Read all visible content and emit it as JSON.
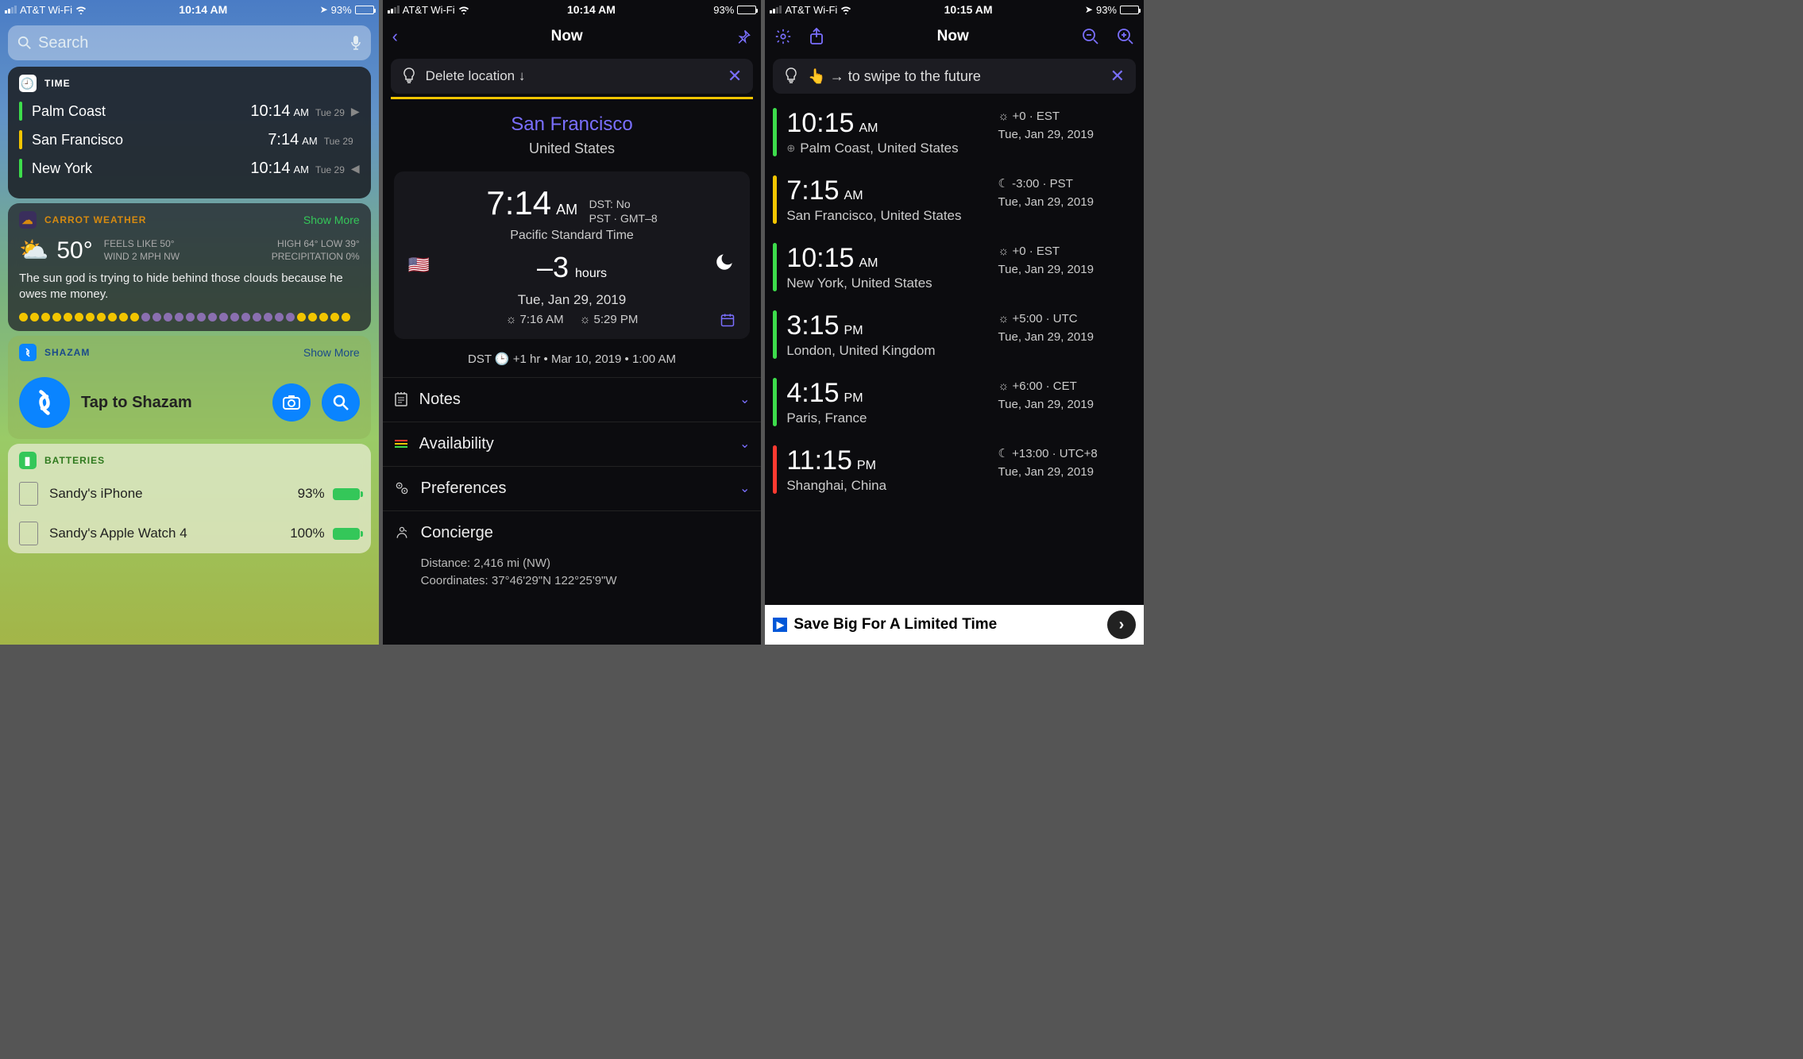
{
  "status": {
    "carrier": "AT&T Wi-Fi",
    "time_a": "10:14 AM",
    "time_b": "10:14 AM",
    "time_c": "10:15 AM",
    "battery_pct": "93%"
  },
  "phone1": {
    "search_placeholder": "Search",
    "time_widget": {
      "title": "TIME",
      "rows": [
        {
          "city": "Palm Coast",
          "time": "10:14",
          "ampm": "AM",
          "date": "Tue 29",
          "bar": "green",
          "chev": "▶"
        },
        {
          "city": "San Francisco",
          "time": "7:14",
          "ampm": "AM",
          "date": "Tue 29",
          "bar": "yellow",
          "chev": ""
        },
        {
          "city": "New York",
          "time": "10:14",
          "ampm": "AM",
          "date": "Tue 29",
          "bar": "green",
          "chev": "◀"
        }
      ]
    },
    "carrot": {
      "title": "CARROT WEATHER",
      "show_more": "Show More",
      "temp": "50°",
      "feels": "FEELS LIKE 50°",
      "wind": "WIND 2 MPH NW",
      "high_low": "HIGH 64° LOW 39°",
      "precip": "PRECIPITATION 0%",
      "text": "The sun god is trying to hide behind those clouds because he owes me money."
    },
    "shazam": {
      "title": "SHAZAM",
      "show_more": "Show More",
      "tap": "Tap to Shazam"
    },
    "batteries": {
      "title": "BATTERIES",
      "rows": [
        {
          "name": "Sandy's iPhone",
          "pct": "93%"
        },
        {
          "name": "Sandy's Apple Watch 4",
          "pct": "100%"
        }
      ]
    }
  },
  "phone2": {
    "nav_title": "Now",
    "tip": "Delete location ↓",
    "location": "San Francisco",
    "country": "United States",
    "time": "7:14",
    "ampm": "AM",
    "dst": "DST: No",
    "tz_short": "PST · GMT–8",
    "tz_name": "Pacific Standard Time",
    "offset": "–3",
    "offset_unit": "hours",
    "date": "Tue, Jan 29, 2019",
    "sunrise": "7:16 AM",
    "sunset": "5:29 PM",
    "dst_line": "DST 🕒 +1 hr • Mar 10, 2019 • 1:00 AM",
    "sections": {
      "notes": "Notes",
      "avail": "Availability",
      "prefs": "Preferences",
      "concierge": "Concierge"
    },
    "concierge_distance": "Distance: 2,416 mi (NW)",
    "concierge_coords": "Coordinates: 37°46'29\"N 122°25'9\"W"
  },
  "phone3": {
    "nav_title": "Now",
    "tip": "👆 → to swipe to the future",
    "rows": [
      {
        "bar": "green",
        "time": "10:15",
        "ampm": "AM",
        "offset": "☼ +0 · EST",
        "date": "Tue, Jan 29, 2019",
        "loc": "Palm Coast, United States",
        "crosshair": true
      },
      {
        "bar": "yellow",
        "time": "7:15",
        "ampm": "AM",
        "offset": "☾ -3:00 · PST",
        "date": "Tue, Jan 29, 2019",
        "loc": "San Francisco, United States"
      },
      {
        "bar": "green",
        "time": "10:15",
        "ampm": "AM",
        "offset": "☼ +0 · EST",
        "date": "Tue, Jan 29, 2019",
        "loc": "New York, United States"
      },
      {
        "bar": "green",
        "time": "3:15",
        "ampm": "PM",
        "offset": "☼ +5:00 · UTC",
        "date": "Tue, Jan 29, 2019",
        "loc": "London, United Kingdom"
      },
      {
        "bar": "green",
        "time": "4:15",
        "ampm": "PM",
        "offset": "☼ +6:00 · CET",
        "date": "Tue, Jan 29, 2019",
        "loc": "Paris, France"
      },
      {
        "bar": "red",
        "time": "11:15",
        "ampm": "PM",
        "offset": "☾ +13:00 · UTC+8",
        "date": "Tue, Jan 29, 2019",
        "loc": "Shanghai, China"
      }
    ],
    "ad": "Save Big For A Limited Time"
  }
}
